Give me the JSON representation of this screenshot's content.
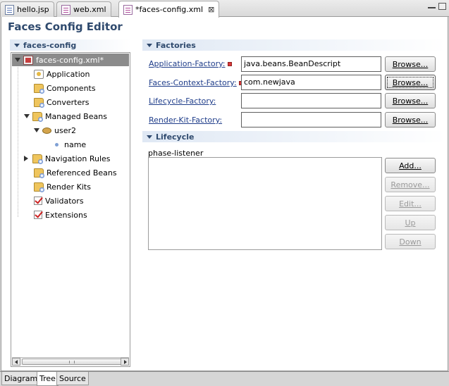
{
  "editor_tabs": [
    {
      "label": "hello.jsp",
      "icon": "jsp-file-icon",
      "active": false
    },
    {
      "label": "web.xml",
      "icon": "xml-file-icon",
      "active": false
    },
    {
      "label": "*faces-config.xml",
      "icon": "xml-file-icon",
      "active": true,
      "close": "⊠"
    }
  ],
  "form_title": "Faces Config Editor",
  "tree": {
    "header": "faces-config",
    "root": "faces-config.xml*",
    "items": [
      {
        "label": "Application",
        "icon": "application-icon"
      },
      {
        "label": "Components",
        "icon": "folder-icon"
      },
      {
        "label": "Converters",
        "icon": "folder-icon"
      },
      {
        "label": "Managed Beans",
        "icon": "folder-icon",
        "expanded": true
      },
      {
        "label": "user2",
        "icon": "bean-icon",
        "expanded": true
      },
      {
        "label": "name",
        "icon": "property-icon"
      },
      {
        "label": "Navigation Rules",
        "icon": "folder-icon",
        "expanded": false
      },
      {
        "label": "Referenced Beans",
        "icon": "folder-icon"
      },
      {
        "label": "Render Kits",
        "icon": "folder-icon"
      },
      {
        "label": "Validators",
        "icon": "check-icon"
      },
      {
        "label": "Extensions",
        "icon": "check-icon"
      }
    ],
    "scroll_grip": "III"
  },
  "factories": {
    "header": "Factories",
    "rows": [
      {
        "label": "Application-Factory:",
        "required": true,
        "value": "java.beans.BeanDescript",
        "button": "Browse..."
      },
      {
        "label": "Faces-Context-Factory:",
        "required": true,
        "value": "com.newjava",
        "button": "Browse..."
      },
      {
        "label": "Lifecycle-Factory:",
        "required": false,
        "value": "",
        "button": "Browse..."
      },
      {
        "label": "Render-Kit-Factory:",
        "required": false,
        "value": "",
        "button": "Browse..."
      }
    ]
  },
  "lifecycle": {
    "header": "Lifecycle",
    "list_label": "phase-listener",
    "buttons": [
      {
        "label": "Add...",
        "enabled": true
      },
      {
        "label": "Remove...",
        "enabled": false
      },
      {
        "label": "Edit...",
        "enabled": false
      },
      {
        "label": "Up",
        "enabled": false
      },
      {
        "label": "Down",
        "enabled": false
      }
    ]
  },
  "page_tabs": [
    {
      "label": "Diagram",
      "active": false
    },
    {
      "label": "Tree",
      "active": true
    },
    {
      "label": "Source",
      "active": false
    }
  ]
}
